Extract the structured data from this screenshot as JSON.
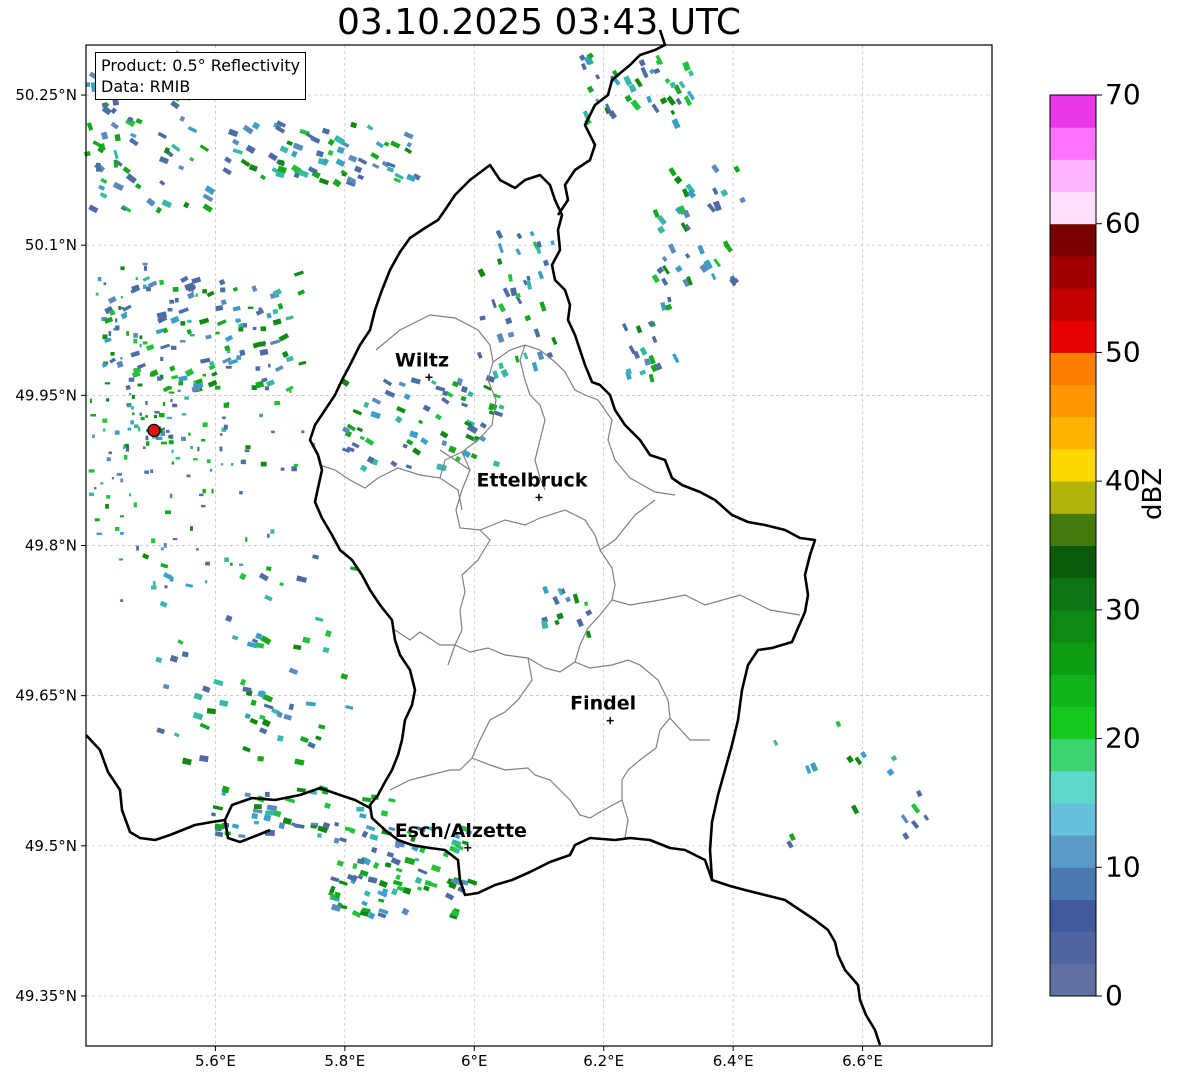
{
  "title": "03.10.2025 03:43 UTC",
  "info": {
    "product": "Product: 0.5° Reflectivity",
    "data": "Data: RMIB"
  },
  "axes": {
    "lon_ticks": [
      "5.6°E",
      "5.8°E",
      "6°E",
      "6.2°E",
      "6.4°E",
      "6.6°E"
    ],
    "lon_values": [
      5.6,
      5.8,
      6.0,
      6.2,
      6.4,
      6.6
    ],
    "lat_ticks": [
      "50.25°N",
      "50.1°N",
      "49.95°N",
      "49.8°N",
      "49.65°N",
      "49.5°N",
      "49.35°N"
    ],
    "lat_values": [
      50.25,
      50.1,
      49.95,
      49.8,
      49.65,
      49.5,
      49.35
    ],
    "lon_range": [
      5.4,
      6.8
    ],
    "lat_range": [
      49.3,
      50.3
    ]
  },
  "places": [
    {
      "name": "Wiltz",
      "lon": 5.93,
      "lat": 49.968
    },
    {
      "name": "Ettelbruck",
      "lon": 6.1,
      "lat": 49.848
    },
    {
      "name": "Findel",
      "lon": 6.21,
      "lat": 49.625
    },
    {
      "name": "Esch/Alzette",
      "lon": 5.99,
      "lat": 49.498
    }
  ],
  "radar_site": {
    "lon": 5.505,
    "lat": 49.915
  },
  "colorbar": {
    "label": "dBZ",
    "ticks": [
      "0",
      "10",
      "20",
      "30",
      "40",
      "50",
      "60",
      "70"
    ],
    "colors": [
      "#6070a0",
      "#4f64a0",
      "#405aa0",
      "#4a7ab0",
      "#5a9ac8",
      "#66c0dc",
      "#5ed8c8",
      "#3cd46e",
      "#14c81e",
      "#10b41a",
      "#0e9c14",
      "#0e8a12",
      "#0c7410",
      "#0a5c0c",
      "#447a0c",
      "#b0b40c",
      "#ffd800",
      "#ffb400",
      "#ff9800",
      "#ff7e00",
      "#e40000",
      "#c20000",
      "#a00000",
      "#780000",
      "#ffe0ff",
      "#ffb4ff",
      "#ff72ff",
      "#e838e8"
    ]
  },
  "echo_palette": [
    "#4a6fa5",
    "#5a8bbf",
    "#3aa0c8",
    "#38b8a8",
    "#22c23a",
    "#14a91d",
    "#0e8a12",
    "#4f6aa2"
  ]
}
